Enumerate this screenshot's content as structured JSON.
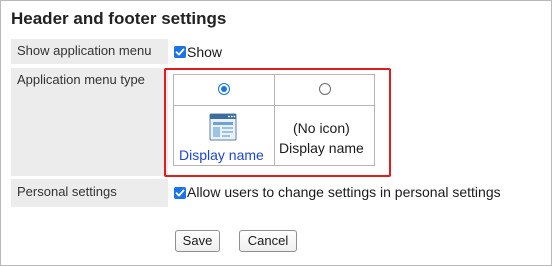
{
  "page": {
    "title": "Header and footer settings"
  },
  "rows": {
    "show_menu": {
      "label": "Show application menu",
      "checkbox_label": "Show",
      "checked": true
    },
    "menu_type": {
      "label": "Application menu type",
      "options": [
        {
          "id": "with_icon",
          "selected": true,
          "caption": "Display name",
          "icon": "app-window-icon"
        },
        {
          "id": "no_icon",
          "selected": false,
          "caption_line1": "(No icon)",
          "caption_line2": "Display name"
        }
      ]
    },
    "personal": {
      "label": "Personal settings",
      "checkbox_label": "Allow users to change settings in personal settings",
      "checked": true
    }
  },
  "buttons": {
    "save": "Save",
    "cancel": "Cancel"
  },
  "colors": {
    "accent": "#1a73e8",
    "link": "#1d47d1",
    "highlight": "#e11c1c",
    "label_bg": "#ececec"
  }
}
